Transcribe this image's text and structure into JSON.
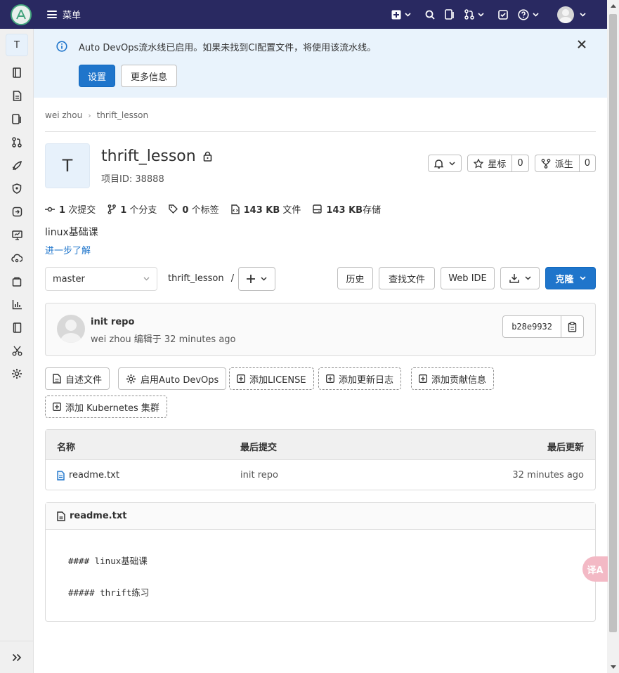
{
  "topbar": {
    "menu_label": "菜单"
  },
  "sidebar": {
    "project_initial": "T"
  },
  "alert": {
    "text": "Auto DevOps流水线已启用。如果未找到CI配置文件，将使用该流水线。",
    "settings_btn": "设置",
    "more_btn": "更多信息"
  },
  "breadcrumb": {
    "owner": "wei zhou",
    "project": "thrift_lesson"
  },
  "project": {
    "initial": "T",
    "name": "thrift_lesson",
    "id_text": "项目ID: 38888",
    "star_label": "星标",
    "star_count": "0",
    "fork_label": "派生",
    "fork_count": "0"
  },
  "stats": {
    "commits_num": "1",
    "commits_label": "次提交",
    "branches_num": "1",
    "branches_label": "个分支",
    "tags_num": "0",
    "tags_label": "个标签",
    "files_size": "143 KB",
    "files_label": "文件",
    "storage_size": "143 KB",
    "storage_label": "存储"
  },
  "description": "linux基础课",
  "learn_more": "进一步了解",
  "repo_bar": {
    "branch": "master",
    "path": "thrift_lesson",
    "path_sep": "/",
    "history": "历史",
    "find_file": "查找文件",
    "web_ide": "Web IDE",
    "clone": "克隆"
  },
  "commit": {
    "title": "init repo",
    "meta": "wei zhou 编辑于 32 minutes ago",
    "sha": "b28e9932"
  },
  "chips": {
    "readme": "自述文件",
    "devops": "启用Auto DevOps",
    "license": "添加LICENSE",
    "changelog": "添加更新日志",
    "contrib": "添加贡献信息",
    "k8s": "添加 Kubernetes 集群"
  },
  "filetable": {
    "headers": [
      "名称",
      "最后提交",
      "最后更新"
    ],
    "rows": [
      {
        "name": "readme.txt",
        "commit": "init repo",
        "updated": "32 minutes ago"
      }
    ]
  },
  "readme": {
    "filename": "readme.txt",
    "line1": "#### linux基础课",
    "line2": "##### thrift练习"
  },
  "float_btn": "译A",
  "colors": {
    "topbar": "#292961",
    "primary": "#1f75cb",
    "alert_bg": "#e9f3fc"
  }
}
